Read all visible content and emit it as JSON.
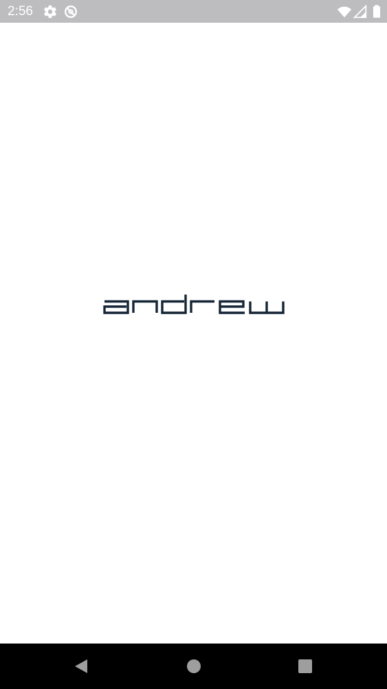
{
  "status_bar": {
    "time": "2:56",
    "icons": [
      "gear-icon",
      "do-not-disturb-icon",
      "wifi-icon",
      "signal-icon",
      "battery-icon"
    ],
    "background": "#bdbcbf"
  },
  "splash": {
    "logo_text": "andrew",
    "logo_color": "#152535",
    "background": "#ffffff"
  },
  "nav_bar": {
    "buttons": [
      "back-icon",
      "home-icon",
      "recents-icon"
    ],
    "background": "#000000",
    "icon_color": "#9e9e9e"
  }
}
